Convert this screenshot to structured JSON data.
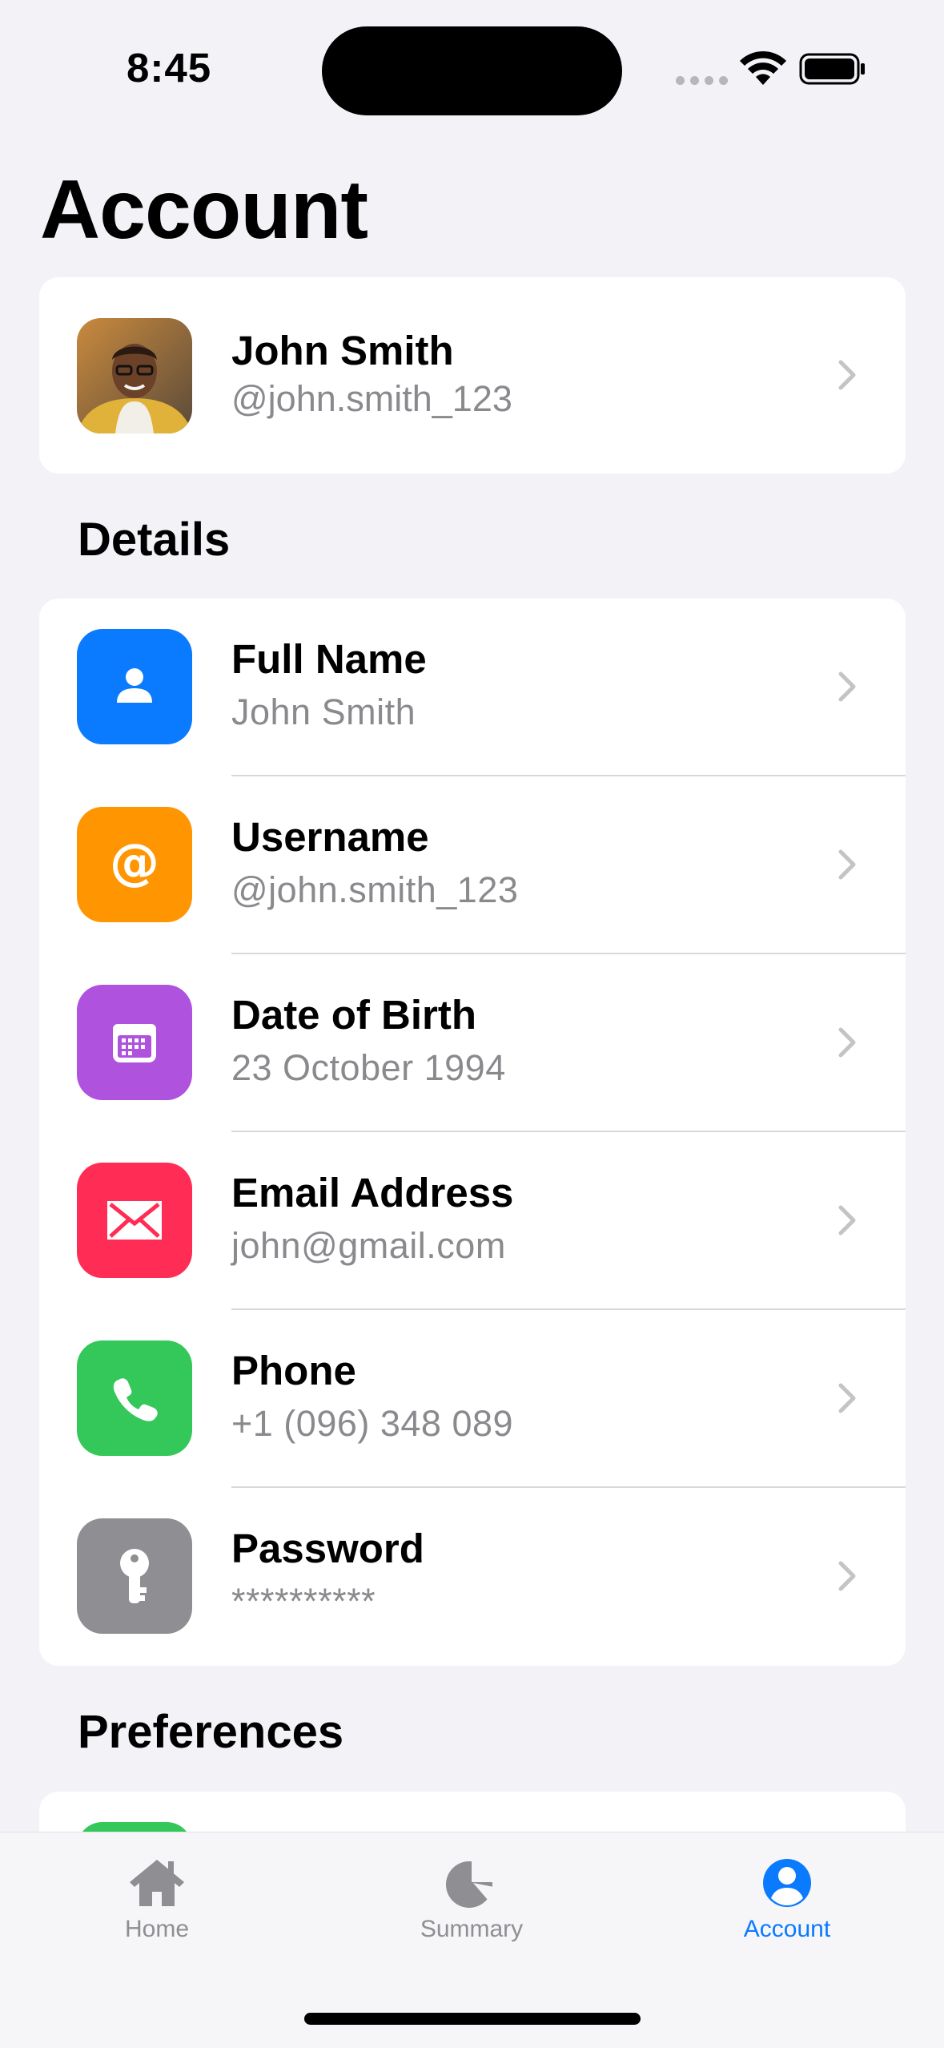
{
  "status_bar": {
    "time": "8:45"
  },
  "page": {
    "title": "Account"
  },
  "profile": {
    "name": "John Smith",
    "handle": "@john.smith_123"
  },
  "sections": {
    "details": "Details",
    "preferences": "Preferences"
  },
  "details": [
    {
      "title": "Full Name",
      "value": "John Smith",
      "icon": "person-icon",
      "color": "#0a7aff"
    },
    {
      "title": "Username",
      "value": "@john.smith_123",
      "icon": "at-sign-icon",
      "color": "#ff9500"
    },
    {
      "title": "Date of Birth",
      "value": "23 October 1994",
      "icon": "calendar-icon",
      "color": "#af52de"
    },
    {
      "title": "Email Address",
      "value": "john@gmail.com",
      "icon": "envelope-icon",
      "color": "#ff2d55"
    },
    {
      "title": "Phone",
      "value": "+1 (096) 348 089",
      "icon": "phone-icon",
      "color": "#34c759"
    },
    {
      "title": "Password",
      "value": "**********",
      "icon": "key-icon",
      "color": "#8e8e93"
    }
  ],
  "tabbar": {
    "tabs": [
      {
        "label": "Home",
        "icon": "house-icon",
        "active": false
      },
      {
        "label": "Summary",
        "icon": "pie-chart-icon",
        "active": false
      },
      {
        "label": "Account",
        "icon": "person-circle-icon",
        "active": true
      }
    ],
    "active_color": "#0a7aff",
    "inactive_color": "#8e8e93"
  }
}
